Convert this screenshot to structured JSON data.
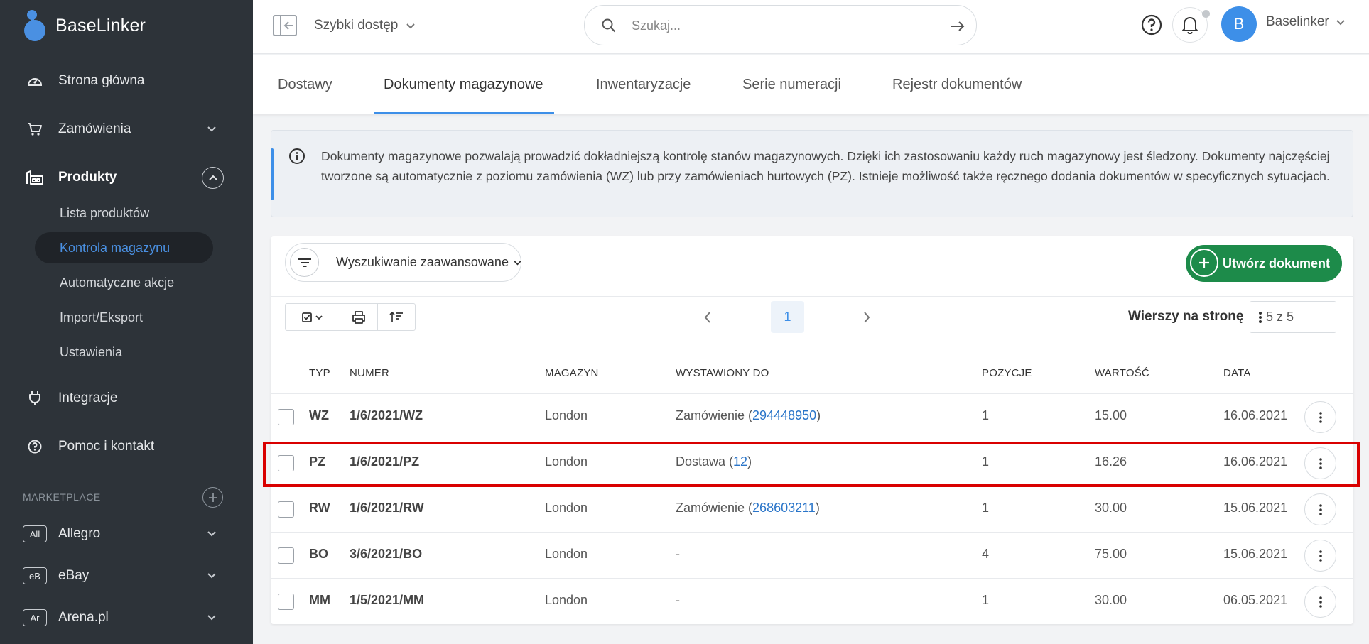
{
  "app": {
    "logo_text": "BaseLinker"
  },
  "sidebar": {
    "items": [
      {
        "label": "Strona główna",
        "icon": "dashboard-gauge-icon"
      },
      {
        "label": "Zamówienia",
        "icon": "cart-icon"
      },
      {
        "label": "Produkty",
        "icon": "warehouse-icon"
      },
      {
        "label": "Integracje",
        "icon": "plug-icon"
      },
      {
        "label": "Pomoc i kontakt",
        "icon": "help-circle-icon"
      }
    ],
    "products_sub": [
      {
        "label": "Lista produktów"
      },
      {
        "label": "Kontrola magazynu"
      },
      {
        "label": "Automatyczne akcje"
      },
      {
        "label": "Import/Eksport"
      },
      {
        "label": "Ustawienia"
      }
    ],
    "marketplace_label": "MARKETPLACE",
    "marketplaces": [
      {
        "badge": "All",
        "label": "Allegro"
      },
      {
        "badge": "eB",
        "label": "eBay"
      },
      {
        "badge": "Ar",
        "label": "Arena.pl"
      }
    ]
  },
  "topbar": {
    "quick_access": "Szybki dostęp",
    "search_placeholder": "Szukaj...",
    "avatar_letter": "B",
    "user_name": "Baselinker"
  },
  "tabs": [
    {
      "label": "Dostawy"
    },
    {
      "label": "Dokumenty magazynowe"
    },
    {
      "label": "Inwentaryzacje"
    },
    {
      "label": "Serie numeracji"
    },
    {
      "label": "Rejestr dokumentów"
    }
  ],
  "info": {
    "text": "Dokumenty magazynowe pozwalają prowadzić dokładniejszą kontrolę stanów magazynowych. Dzięki ich zastosowaniu każdy ruch magazynowy jest śledzony. Dokumenty najczęściej tworzone są automatycznie z poziomu zamówienia (WZ) lub przy zamówieniach hurtowych (PZ). Istnieje możliwość także ręcznego dodania dokumentów w specyficznych sytuacjach."
  },
  "toolbar": {
    "advanced_search": "Wyszukiwanie zaawansowane",
    "create_button": "Utwórz dokument",
    "current_page": "1",
    "rows_label": "Wierszy na stronę",
    "rows_value": "5 z 5"
  },
  "table": {
    "headers": {
      "typ": "TYP",
      "numer": "NUMER",
      "magazyn": "MAGAZYN",
      "wystawiony": "WYSTAWIONY DO",
      "pozycje": "POZYCJE",
      "wartosc": "WARTOŚĆ",
      "data": "DATA"
    },
    "rows": [
      {
        "typ": "WZ",
        "numer": "1/6/2021/WZ",
        "magazyn": "London",
        "ref_prefix": "Zamówienie (",
        "ref_link": "294448950",
        "ref_suffix": ")",
        "pozycje": "1",
        "wartosc": "15.00",
        "data": "16.06.2021"
      },
      {
        "typ": "PZ",
        "numer": "1/6/2021/PZ",
        "magazyn": "London",
        "ref_prefix": "Dostawa (",
        "ref_link": "12",
        "ref_suffix": ")",
        "pozycje": "1",
        "wartosc": "16.26",
        "data": "16.06.2021"
      },
      {
        "typ": "RW",
        "numer": "1/6/2021/RW",
        "magazyn": "London",
        "ref_prefix": "Zamówienie (",
        "ref_link": "268603211",
        "ref_suffix": ")",
        "pozycje": "1",
        "wartosc": "30.00",
        "data": "15.06.2021"
      },
      {
        "typ": "BO",
        "numer": "3/6/2021/BO",
        "magazyn": "London",
        "ref_prefix": "-",
        "ref_link": "",
        "ref_suffix": "",
        "pozycje": "4",
        "wartosc": "75.00",
        "data": "15.06.2021"
      },
      {
        "typ": "MM",
        "numer": "1/5/2021/MM",
        "magazyn": "London",
        "ref_prefix": "-",
        "ref_link": "",
        "ref_suffix": "",
        "pozycje": "1",
        "wartosc": "30.00",
        "data": "06.05.2021"
      }
    ]
  },
  "colors": {
    "accent": "#3d8fe8",
    "sidebar_bg": "#2d3339",
    "create_button": "#1d8b4a",
    "highlight": "#d90000",
    "link": "#2a75c9"
  }
}
